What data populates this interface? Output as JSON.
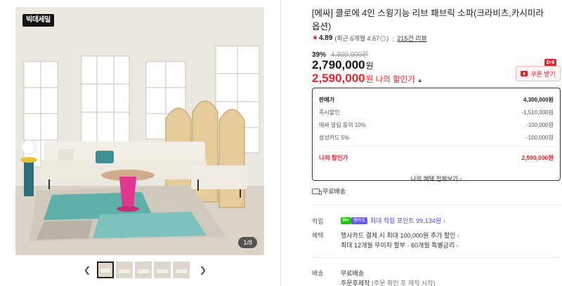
{
  "gallery": {
    "badge": "빅데세일",
    "counter": "1/8",
    "prev_icon": "chevron-left-icon",
    "next_icon": "chevron-right-icon",
    "thumbnail_count": 5
  },
  "product": {
    "title": "[에싸] 클로에 4인 스윙기능 리브 패브릭 소파(크라비츠,카시미라 옵션)",
    "rating": {
      "score": "4.89",
      "recent": "(최근 6개월 4.67",
      "recent_close": ")",
      "reviews": "215건 리뷰"
    },
    "discount_percent": "39%",
    "original_price": "4,300,000원",
    "sale_price": "2,790,000",
    "my_price": "2,590,000",
    "unit": "원",
    "my_price_label": "나의 할인가",
    "coupon": {
      "dday": "D-6",
      "label": "쿠폰 받기"
    }
  },
  "breakdown": {
    "rows": [
      {
        "label": "판매가",
        "value": "4,300,000원"
      },
      {
        "label": "즉시할인",
        "value": "-1,510,000원"
      },
      {
        "label": "에싸 알림 동의 10%",
        "value": "-100,000원"
      },
      {
        "label": "삼성카드 5%",
        "value": "-100,000원"
      }
    ],
    "total_label": "나의 할인가",
    "total_value": "2,590,000원",
    "more_label": "나의 혜택 전체보기"
  },
  "delivery_top": "무료배송",
  "points": {
    "label": "적립",
    "badge_n": "N+",
    "badge_plus": "멤버십",
    "text": "최대 적립 포인트 99,134원"
  },
  "benefits": {
    "label": "혜택",
    "lines": [
      "행사카드 결제 시 최대 100,000원 추가 할인",
      "최대 12개월 무이자 할부 · 60개월 특별금리"
    ]
  },
  "shipping": {
    "label": "배송",
    "line1": "무료배송",
    "line2": "주문후제작",
    "line2_note": "(주문 확인 후 제작 시작)"
  },
  "colors": {
    "accent_red": "#e8242d",
    "point_purple": "#5a48d6",
    "naver_green": "#1ec800"
  }
}
